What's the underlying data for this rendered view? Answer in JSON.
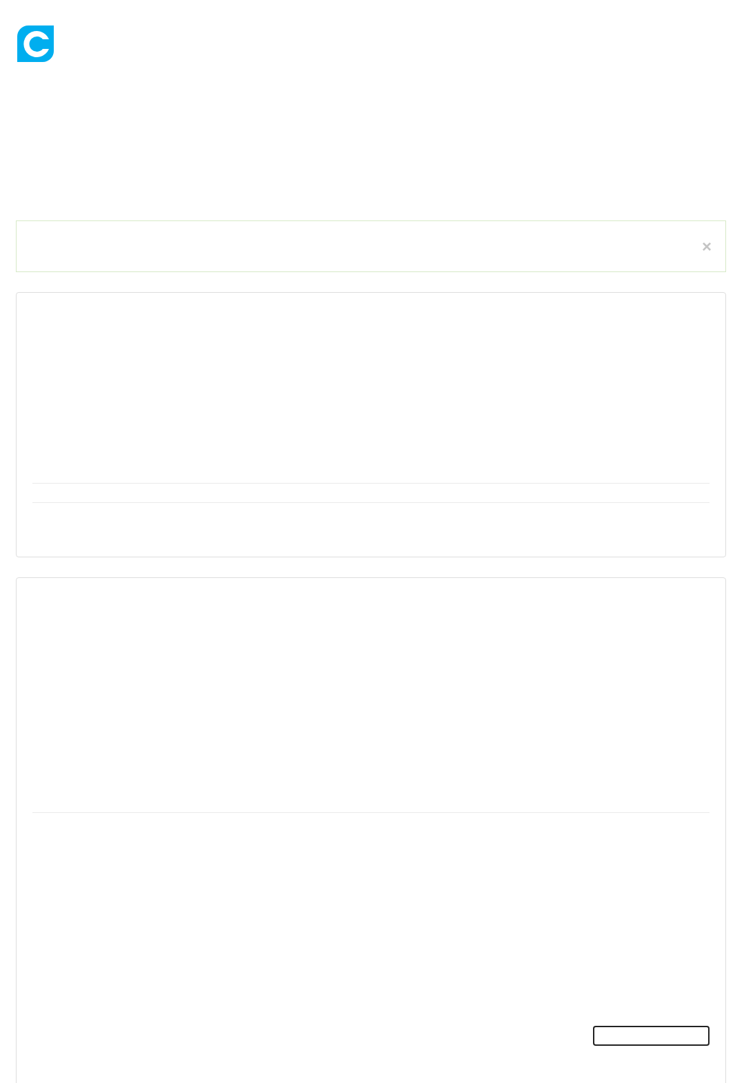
{
  "alert": {
    "close": "×"
  },
  "cards": [
    {
      "kind": "summary"
    },
    {
      "kind": "form"
    }
  ]
}
